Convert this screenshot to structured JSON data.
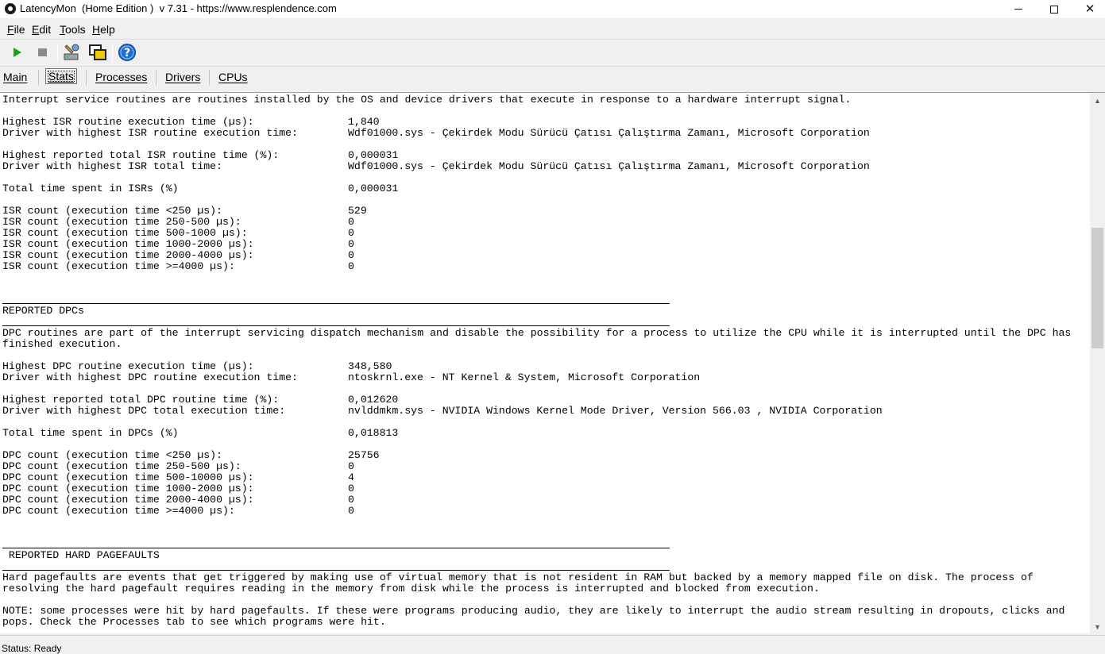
{
  "window": {
    "title": "LatencyMon  (Home Edition )  v 7.31 - https://www.resplendence.com"
  },
  "menu": [
    {
      "key": "F",
      "rest": "ile"
    },
    {
      "key": "E",
      "rest": "dit"
    },
    {
      "key": "T",
      "rest": "ools"
    },
    {
      "key": "H",
      "rest": "elp"
    }
  ],
  "toolbar": {
    "icons": [
      "play-icon",
      "stop-icon",
      "driver-tool-icon",
      "windows-icon",
      "help-icon"
    ],
    "colors": {
      "play": "#1aa31a",
      "stop": "#8a8a8a",
      "help": "#1e6fd0"
    }
  },
  "tabs": [
    "Main",
    "Stats",
    "Processes",
    "Drivers",
    "CPUs"
  ],
  "active_tab": "Stats",
  "report": {
    "isr_intro": "Interrupt service routines are routines installed by the OS and device drivers that execute in response to a hardware interrupt signal.",
    "isr_rows": [
      {
        "label": "Highest ISR routine execution time (µs):",
        "value": "1,840"
      },
      {
        "label": "Driver with highest ISR routine execution time:",
        "value": "Wdf01000.sys - Çekirdek Modu Sürücü Çatısı Çalıştırma Zamanı, Microsoft Corporation"
      },
      {
        "label": "Highest reported total ISR routine time (%):",
        "value": "0,000031"
      },
      {
        "label": "Driver with highest ISR total time:",
        "value": "Wdf01000.sys - Çekirdek Modu Sürücü Çatısı Çalıştırma Zamanı, Microsoft Corporation"
      },
      {
        "label": "Total time spent in ISRs (%)",
        "value": "0,000031"
      }
    ],
    "isr_counts": [
      {
        "label": "ISR count (execution time <250 µs):",
        "value": "529"
      },
      {
        "label": "ISR count (execution time 250-500 µs):",
        "value": "0"
      },
      {
        "label": "ISR count (execution time 500-1000 µs):",
        "value": "0"
      },
      {
        "label": "ISR count (execution time 1000-2000 µs):",
        "value": "0"
      },
      {
        "label": "ISR count (execution time 2000-4000 µs):",
        "value": "0"
      },
      {
        "label": "ISR count (execution time >=4000 µs):",
        "value": "0"
      }
    ],
    "dpc_header": "REPORTED DPCs",
    "dpc_intro_1": "DPC routines are part of the interrupt servicing dispatch mechanism and disable the possibility for a process to utilize the CPU while it is interrupted until the DPC has",
    "dpc_intro_2": "finished execution.",
    "dpc_rows": [
      {
        "label": "Highest DPC routine execution time (µs):",
        "value": "348,580"
      },
      {
        "label": "Driver with highest DPC routine execution time:",
        "value": "ntoskrnl.exe - NT Kernel & System, Microsoft Corporation"
      },
      {
        "label": "Highest reported total DPC routine time (%):",
        "value": "0,012620"
      },
      {
        "label": "Driver with highest DPC total execution time:",
        "value": "nvlddmkm.sys - NVIDIA Windows Kernel Mode Driver, Version 566.03 , NVIDIA Corporation"
      },
      {
        "label": "Total time spent in DPCs (%)",
        "value": "0,018813"
      }
    ],
    "dpc_counts": [
      {
        "label": "DPC count (execution time <250 µs):",
        "value": "25756"
      },
      {
        "label": "DPC count (execution time 250-500 µs):",
        "value": "0"
      },
      {
        "label": "DPC count (execution time 500-10000 µs):",
        "value": "4"
      },
      {
        "label": "DPC count (execution time 1000-2000 µs):",
        "value": "0"
      },
      {
        "label": "DPC count (execution time 2000-4000 µs):",
        "value": "0"
      },
      {
        "label": "DPC count (execution time >=4000 µs):",
        "value": "0"
      }
    ],
    "pf_header": " REPORTED HARD PAGEFAULTS",
    "pf_intro_1": "Hard pagefaults are events that get triggered by making use of virtual memory that is not resident in RAM but backed by a memory mapped file on disk. The process of",
    "pf_intro_2": "resolving the hard pagefault requires reading in the memory from disk while the process is interrupted and blocked from execution.",
    "pf_note_1": "NOTE: some processes were hit by hard pagefaults. If these were programs producing audio, they are likely to interrupt the audio stream resulting in dropouts, clicks and",
    "pf_note_2": "pops. Check the Processes tab to see which programs were hit."
  },
  "status": "Status: Ready"
}
